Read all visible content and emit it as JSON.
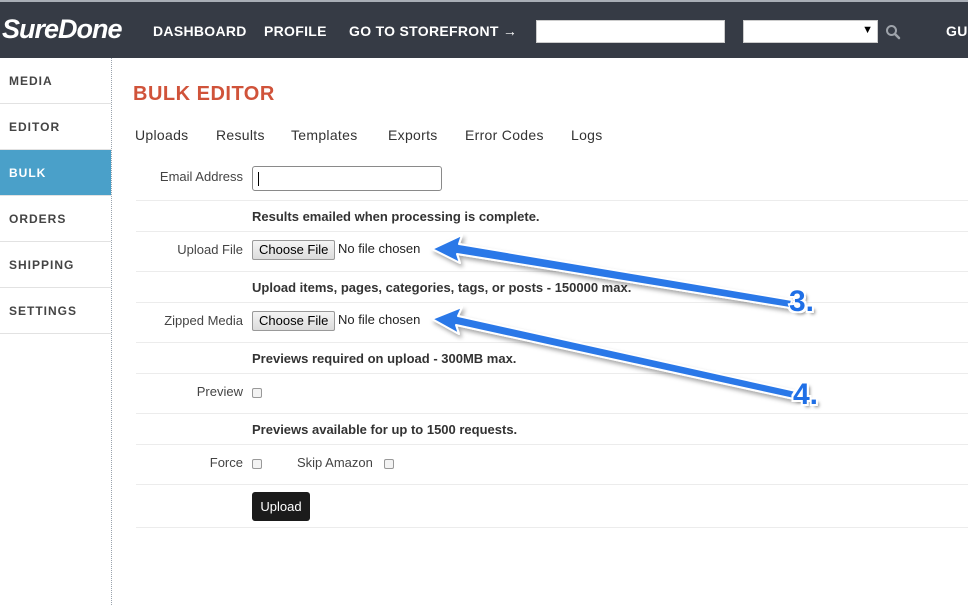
{
  "header": {
    "logo": "SureDone",
    "nav": [
      "DASHBOARD",
      "PROFILE",
      "GO TO STOREFRONT →",
      "GUI"
    ],
    "search_value": "",
    "select_value": ""
  },
  "sidebar": {
    "items": [
      {
        "label": "MEDIA"
      },
      {
        "label": "EDITOR"
      },
      {
        "label": "BULK"
      },
      {
        "label": "ORDERS"
      },
      {
        "label": "SHIPPING"
      },
      {
        "label": "SETTINGS"
      }
    ],
    "active": "BULK"
  },
  "main": {
    "title": "BULK EDITOR",
    "tabs": [
      "Uploads",
      "Results",
      "Templates",
      "Exports",
      "Error Codes",
      "Logs"
    ],
    "form": {
      "email_label": "Email Address",
      "email_value": "",
      "email_help": "Results emailed when processing is complete.",
      "upload_label": "Upload File",
      "upload_button": "Choose File",
      "upload_status": "No file chosen",
      "upload_help": "Upload items, pages, categories, tags, or posts - 150000 max.",
      "media_label": "Zipped Media",
      "media_button": "Choose File",
      "media_status": "No file chosen",
      "media_help": "Previews required on upload - 300MB max.",
      "preview_label": "Preview",
      "preview_help": "Previews available for up to 1500 requests.",
      "force_label": "Force",
      "skip_amazon_label": "Skip Amazon",
      "submit_label": "Upload"
    }
  },
  "annotations": {
    "arrow_3_label": "3.",
    "arrow_4_label": "4.",
    "arrow_color": "#1f6fe6"
  },
  "colors": {
    "topbar": "#363b45",
    "sidebar_active": "#4aa0c9",
    "title": "#d0533a"
  }
}
